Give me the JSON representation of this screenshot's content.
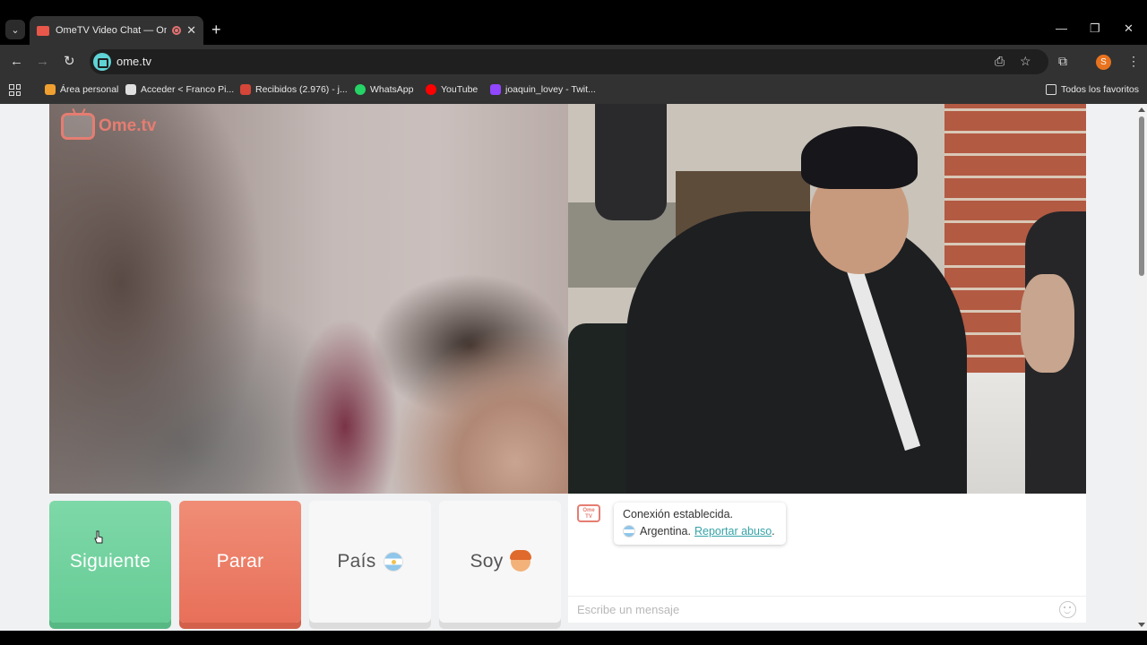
{
  "browser": {
    "tab_title": "OmeTV Video Chat — Ome",
    "tab_close": "✕",
    "new_tab": "+",
    "url": "ome.tv",
    "window_controls": {
      "minimize": "—",
      "restore": "❐",
      "close": "✕"
    },
    "profile_initial": "S"
  },
  "bookmarks": [
    {
      "label": "Área personal",
      "icon": "area-personal-icon",
      "color": "#f0a030"
    },
    {
      "label": "Acceder < Franco Pi...",
      "icon": "wordpress-pi-icon",
      "color": "#e0e0e0"
    },
    {
      "label": "Recibidos (2.976) - j...",
      "icon": "gmail-icon",
      "color": "#d44638"
    },
    {
      "label": "WhatsApp",
      "icon": "whatsapp-icon",
      "color": "#25d366"
    },
    {
      "label": "YouTube",
      "icon": "youtube-icon",
      "color": "#ff0000"
    },
    {
      "label": "joaquin_lovey - Twit...",
      "icon": "twitch-icon",
      "color": "#9146ff"
    }
  ],
  "all_bookmarks_label": "Todos los favoritos",
  "page": {
    "logo_text": "Ome.tv",
    "buttons": {
      "next": "Siguiente",
      "stop": "Parar",
      "country": "País",
      "gender": "Soy"
    },
    "chat": {
      "logo_text": "Ome TV",
      "system_message": "Conexión establecida.",
      "country_text": "Argentina.",
      "report_link": "Reportar abuso",
      "report_suffix": ".",
      "input_placeholder": "Escribe un mensaje"
    }
  },
  "colors": {
    "next_button": "#6fd09c",
    "stop_button": "#ec7a63",
    "accent": "#e57d72",
    "link": "#36a3a8"
  }
}
